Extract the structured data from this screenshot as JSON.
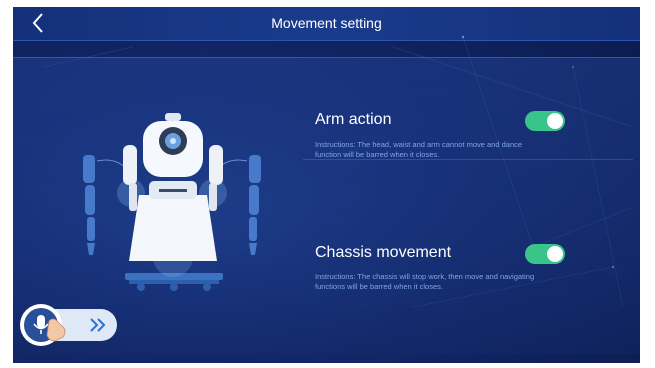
{
  "header": {
    "title": "Movement setting"
  },
  "settings": [
    {
      "label": "Arm action",
      "description_line1": "Instructions: The head, waist and arm cannot move and dance",
      "description_line2": "function will be barred when it closes.",
      "enabled": true
    },
    {
      "label": "Chassis movement",
      "description_line1": "Instructions: The chassis will stop work, then move and navigating",
      "description_line2": "functions will be barred when it closes.",
      "enabled": true
    }
  ],
  "colors": {
    "toggle_on": "#39c58a",
    "background": "#13286a",
    "header": "#1a3b8c",
    "description": "#7fa6e6"
  },
  "icons": {
    "back": "chevron-left-icon",
    "voice": "microphone-icon",
    "expand": "double-chevron-right-icon",
    "hand": "pointing-hand-icon"
  }
}
